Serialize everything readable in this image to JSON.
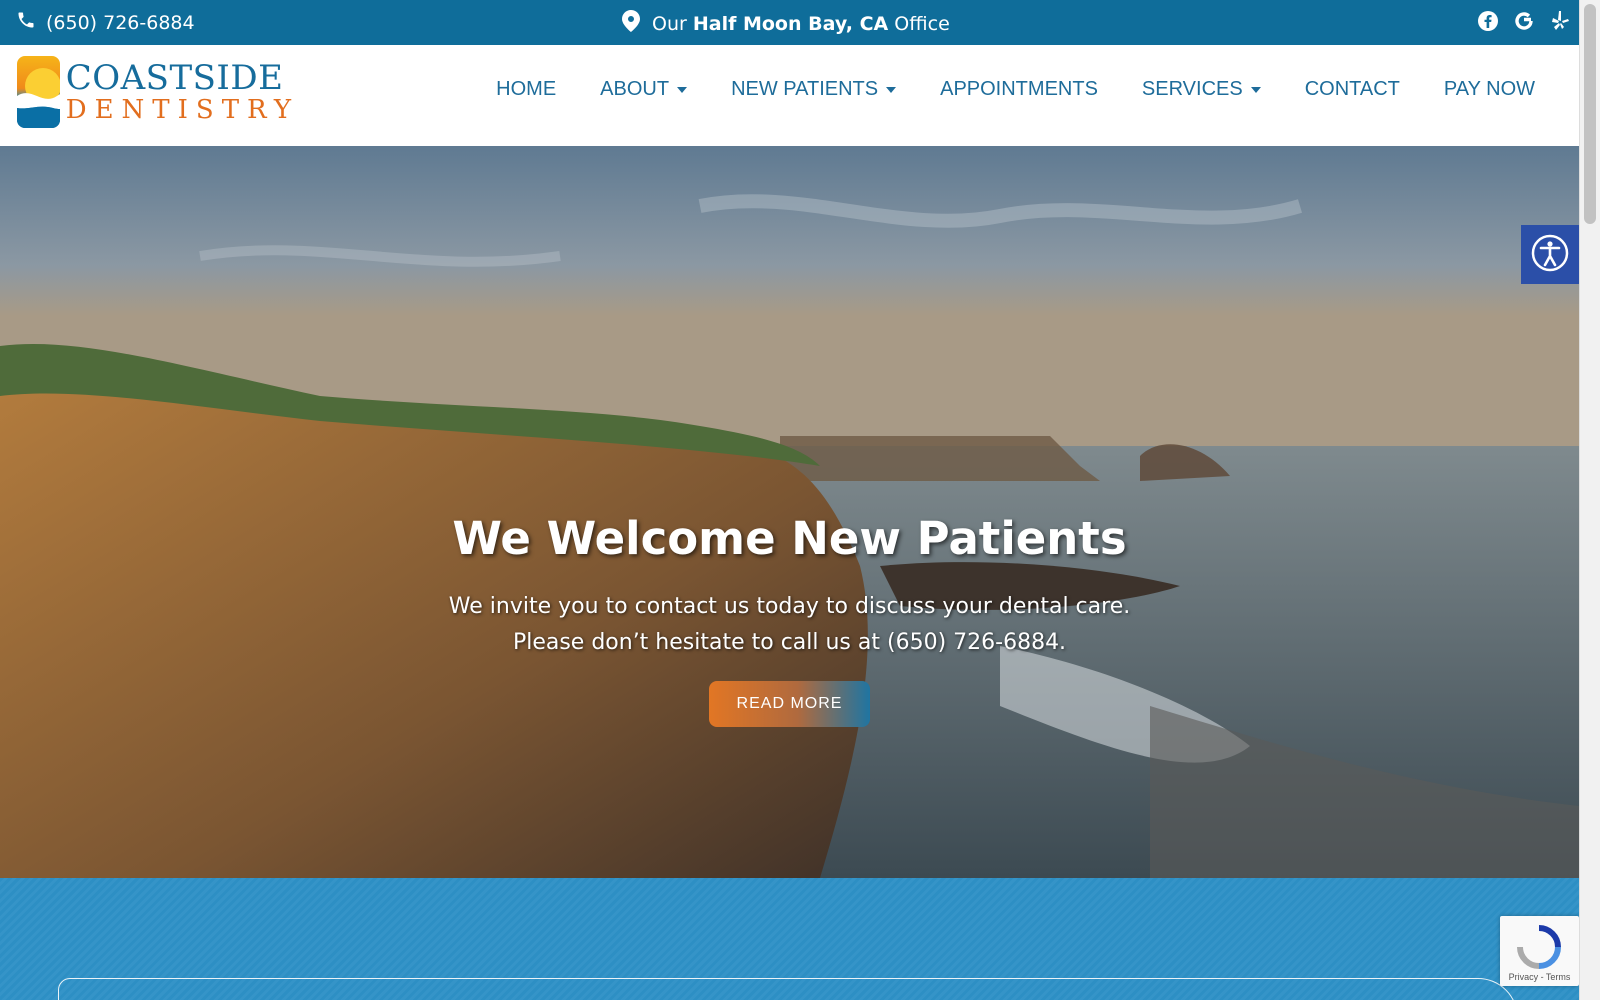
{
  "topbar": {
    "phone": "(650) 726-6884",
    "office_prefix": "Our",
    "office_location": "Half Moon Bay, CA",
    "office_suffix": "Office",
    "social": [
      "facebook-icon",
      "google-icon",
      "yelp-icon"
    ]
  },
  "logo": {
    "line1": "COASTSIDE",
    "line2": "DENTISTRY"
  },
  "nav": {
    "items": [
      {
        "label": "HOME",
        "dropdown": false
      },
      {
        "label": "ABOUT",
        "dropdown": true
      },
      {
        "label": "NEW PATIENTS",
        "dropdown": true
      },
      {
        "label": "APPOINTMENTS",
        "dropdown": false
      },
      {
        "label": "SERVICES",
        "dropdown": true
      },
      {
        "label": "CONTACT",
        "dropdown": false
      },
      {
        "label": "PAY NOW",
        "dropdown": false
      }
    ]
  },
  "hero": {
    "title": "We Welcome New Patients",
    "line1": "We invite you to contact us today to discuss your dental care.",
    "line2": "Please don’t hesitate to call us at (650) 726-6884.",
    "button": "READ MORE"
  },
  "recaptcha": {
    "text": "Privacy - Terms"
  },
  "colors": {
    "topbar": "#0f6d9a",
    "nav_text": "#1e6c9a",
    "logo_orange": "#e26e1e",
    "band": "#2d8fc4",
    "a11y": "#2b4fa8"
  }
}
